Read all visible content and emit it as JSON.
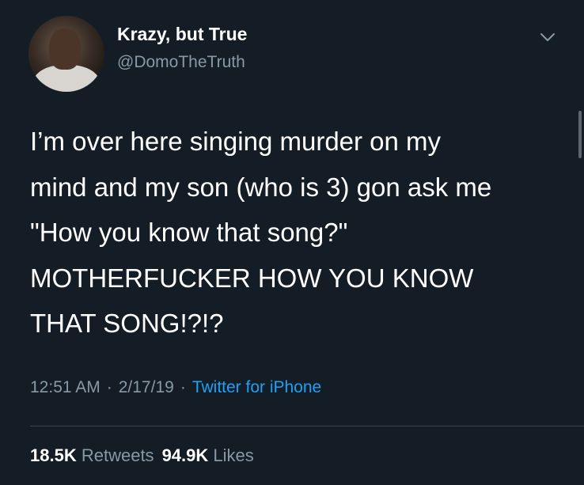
{
  "colors": {
    "background": "#141d26",
    "primary_text": "#ffffff",
    "secondary_text": "#8899a6",
    "link": "#1da1f2",
    "divider": "#38444d"
  },
  "tweet": {
    "author": {
      "display_name": "Krazy, but True",
      "handle": "@DomoTheTruth",
      "avatar_icon": "profile-photo"
    },
    "menu_icon": "chevron-down-icon",
    "body_lines": [
      "I’m over here singing murder on my",
      "mind and my son (who is 3) gon ask me",
      "\"How you know that song?\"",
      "MOTHERFUCKER HOW YOU KNOW",
      "THAT SONG!?!?"
    ],
    "meta": {
      "time": "12:51 AM",
      "date": "2/17/19",
      "separator": "·",
      "source": "Twitter for iPhone"
    },
    "stats": {
      "retweets_count": "18.5K",
      "retweets_label": "Retweets",
      "likes_count": "94.9K",
      "likes_label": "Likes"
    }
  }
}
